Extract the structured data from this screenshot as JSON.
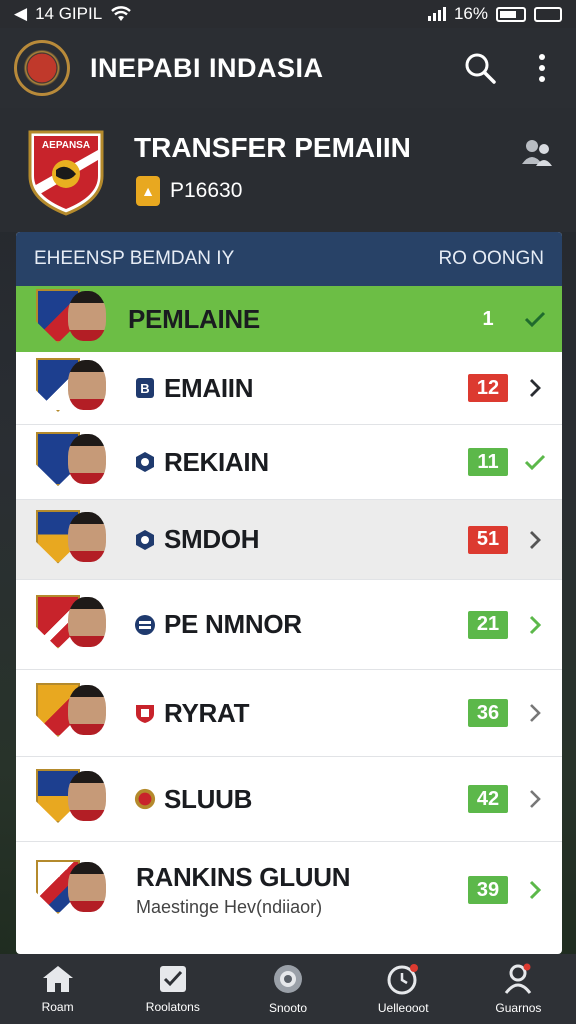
{
  "status_bar": {
    "left_text": "14 GIPIL",
    "battery_text": "16%"
  },
  "app_bar": {
    "title": "INEPABI INDASIA"
  },
  "header": {
    "title": "TRANSFER PEMAIIN",
    "coins": "P16630"
  },
  "list": {
    "head_left": "EHEENSP BEMDAN IY",
    "head_right": "RO OONGN",
    "rows": [
      {
        "name": "PEMLAINE",
        "badge": "1",
        "sub": ""
      },
      {
        "name": "EMAIIN",
        "badge": "12",
        "sub": ""
      },
      {
        "name": "REKIAIN",
        "badge": "11",
        "sub": ""
      },
      {
        "name": "SMDOH",
        "badge": "51",
        "sub": ""
      },
      {
        "name": "PE NMNOR",
        "badge": "21",
        "sub": ""
      },
      {
        "name": "RYRAT",
        "badge": "36",
        "sub": ""
      },
      {
        "name": "SLUUB",
        "badge": "42",
        "sub": ""
      },
      {
        "name": "RANKINS GLUUN",
        "badge": "39",
        "sub": "Maestinge Hev(ndiiaor)"
      }
    ]
  },
  "nav": [
    {
      "label": "Roam",
      "icon": "home-icon"
    },
    {
      "label": "Roolatons",
      "icon": "checklist-icon"
    },
    {
      "label": "Snooto",
      "icon": "ball-icon"
    },
    {
      "label": "Uelleooot",
      "icon": "clock-icon"
    },
    {
      "label": "Guarnos",
      "icon": "user-icon"
    }
  ],
  "colors": {
    "accent_green": "#6cbe45",
    "header_blue": "#284267",
    "badge_red": "#dc3a30",
    "badge_green": "#5cb84a"
  }
}
